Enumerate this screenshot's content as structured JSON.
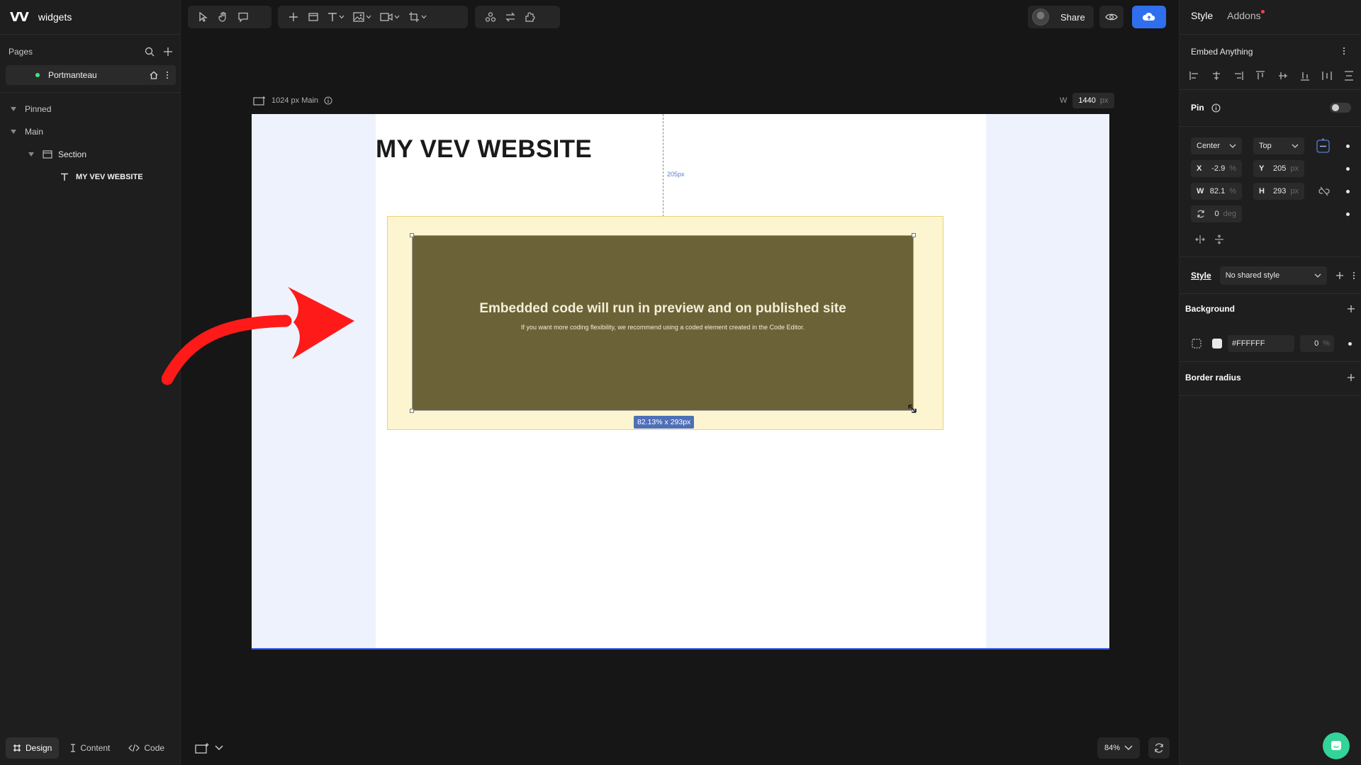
{
  "app": {
    "logo": "VV",
    "project_name": "widgets"
  },
  "left_panel": {
    "pages_label": "Pages",
    "page_item": "Portmanteau",
    "tree": {
      "pinned": "Pinned",
      "main": "Main",
      "section": "Section",
      "text_element": "MY VEV WEBSITE"
    },
    "bottom_tabs": {
      "design": "Design",
      "content": "Content",
      "code": "Code"
    }
  },
  "toolbar": {
    "tools": [
      "select-icon",
      "hand-icon",
      "comment-icon",
      "add-icon",
      "frame-icon",
      "text-icon",
      "image-icon",
      "video-icon",
      "crop-icon",
      "components-icon",
      "swap-icon",
      "plugin-icon"
    ]
  },
  "header_right": {
    "share_label": "Share"
  },
  "canvas": {
    "frame_label": "1024 px Main",
    "width_label": "W",
    "width_value": "1440",
    "width_unit": "px",
    "site_title": "MY VEV WEBSITE",
    "guide_label": "205px",
    "embed_heading": "Embedded code will run in preview and on published site",
    "embed_subtext": "If you want more coding flexibility, we recommend using a coded element created in the Code Editor.",
    "size_badge": "82.13% x 293px",
    "zoom": "84%"
  },
  "right_panel": {
    "tabs": {
      "style": "Style",
      "addons": "Addons"
    },
    "element_name": "Embed Anything",
    "pin_label": "Pin",
    "pin_enabled": false,
    "anchor_x": "Center",
    "anchor_y": "Top",
    "fields": {
      "x": {
        "key": "X",
        "value": "-2.9",
        "unit": "%"
      },
      "y": {
        "key": "Y",
        "value": "205",
        "unit": "px"
      },
      "w": {
        "key": "W",
        "value": "82.1",
        "unit": "%"
      },
      "h": {
        "key": "H",
        "value": "293",
        "unit": "px"
      },
      "rotation": {
        "value": "0",
        "unit": "deg"
      }
    },
    "style_label": "Style",
    "style_value": "No shared style",
    "background_label": "Background",
    "background_hex": "#FFFFFF",
    "background_opacity": "0",
    "background_opacity_unit": "%",
    "border_radius_label": "Border radius"
  },
  "colors": {
    "accent": "#2f6fed",
    "section_bg": "#fdf5cf",
    "embed_bg": "#6b6237",
    "arrow": "#ff1a1a",
    "status_dot": "#4ade80"
  }
}
